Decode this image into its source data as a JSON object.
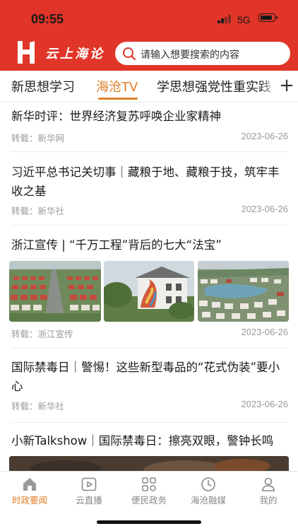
{
  "status_bar": {
    "time": "09:55",
    "network": "5G"
  },
  "header": {
    "app_name": "云上海论",
    "logo_icon": "brand-h-logo",
    "search": {
      "icon": "search-icon",
      "placeholder": "请输入想要搜索的内容"
    },
    "accent_color": "#e03528"
  },
  "tabs": {
    "items": [
      {
        "label": "新思想学习",
        "active": false
      },
      {
        "label": "海沧TV",
        "active": true
      },
      {
        "label": "学思想强党性重实践",
        "active": false
      }
    ],
    "add_label": "+",
    "active_color": "#e0802a"
  },
  "articles": [
    {
      "title": "新华时评：世界经济复苏呼唤企业家精神",
      "source": "转载：新华网",
      "date": "2023-06-26"
    },
    {
      "title": "习近平总书记关切事｜藏粮于地、藏粮于技，筑牢丰收之基",
      "source": "转载：新华社",
      "date": "2023-06-26"
    },
    {
      "title": "浙江宣传 | “千万工程”背后的七大“法宝”",
      "source": "转载：浙江宣传",
      "date": "2023-06-26",
      "images": [
        "aerial-village-photo",
        "mural-building-photo",
        "aerial-town-photo"
      ]
    },
    {
      "title": "国际禁毒日｜警惕！这些新型毒品的“花式伪装”要小心",
      "source": "转载：新华社",
      "date": "2023-06-26"
    },
    {
      "title": "小新Talkshow｜国际禁毒日：擦亮双眼，警钟长鸣",
      "images": [
        "video-cover-photo"
      ]
    }
  ],
  "bottom_nav": {
    "items": [
      {
        "label": "时政要闻",
        "icon": "home-icon",
        "active": true
      },
      {
        "label": "云直播",
        "icon": "live-play-icon",
        "active": false
      },
      {
        "label": "便民政务",
        "icon": "grid-apps-icon",
        "active": false
      },
      {
        "label": "海沧融媒",
        "icon": "clock-icon",
        "active": false
      },
      {
        "label": "我的",
        "icon": "user-icon",
        "active": false
      }
    ]
  }
}
